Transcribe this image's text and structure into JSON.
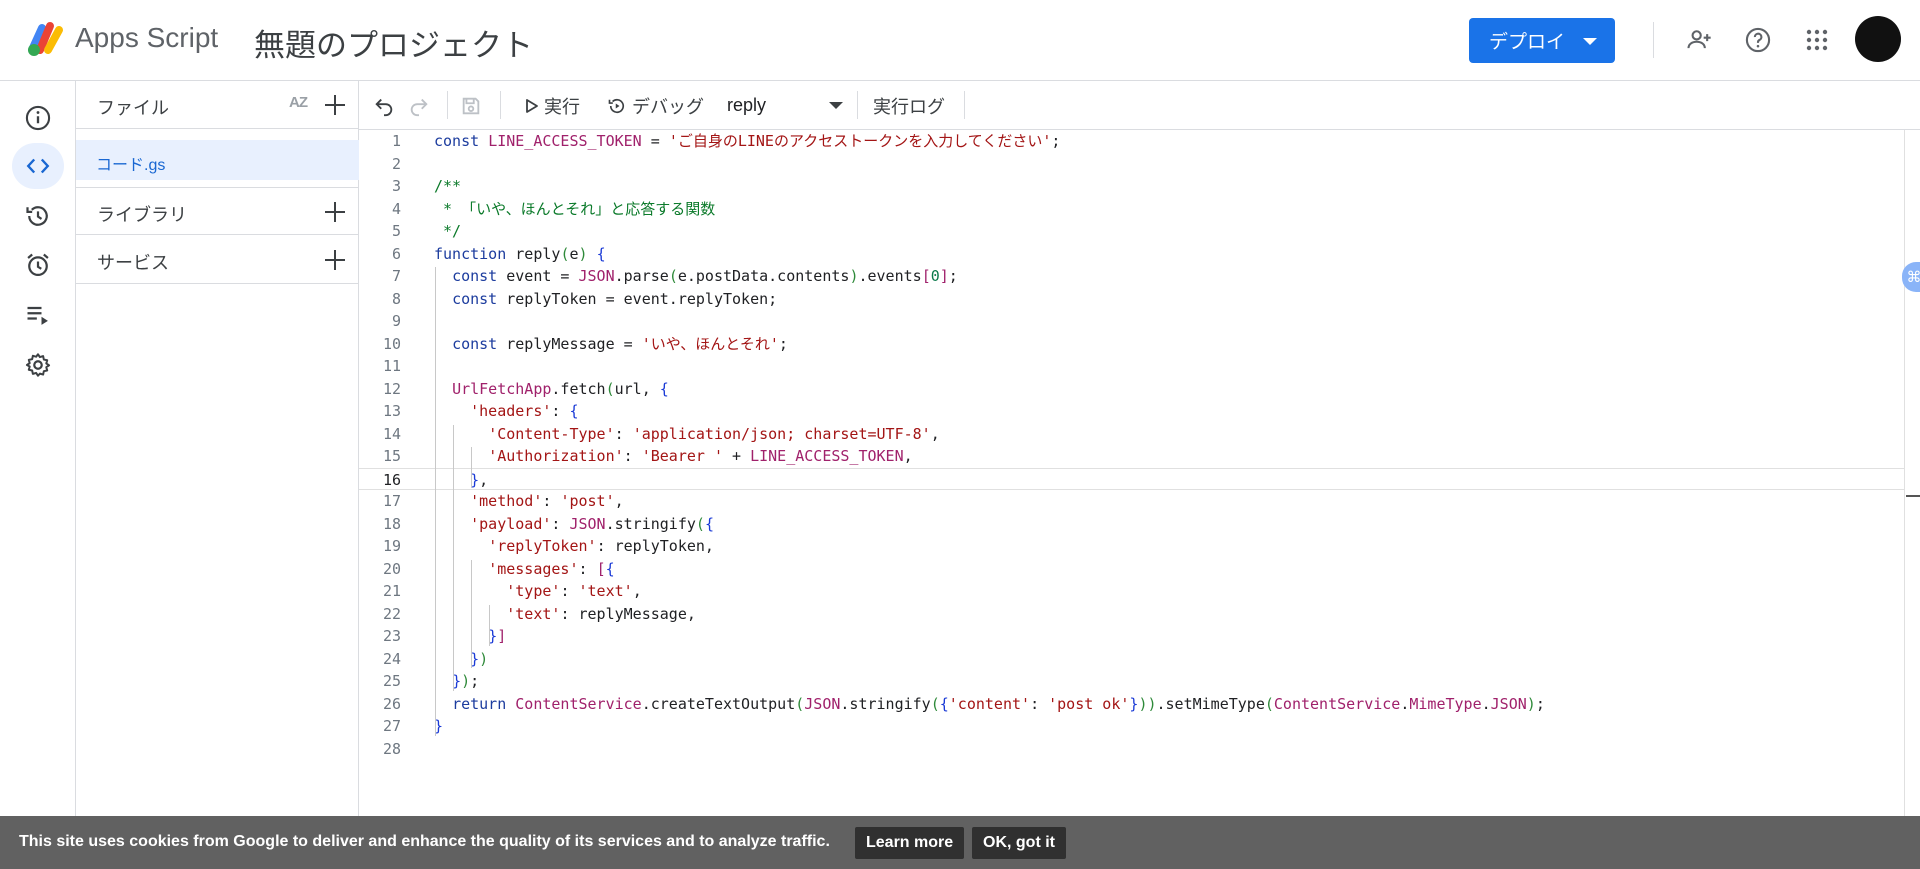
{
  "header": {
    "app_name": "Apps Script",
    "project_title": "無題のプロジェクト",
    "deploy_label": "デプロイ",
    "icons": [
      "add-person-icon",
      "help-icon",
      "apps-grid-icon"
    ]
  },
  "rail": {
    "items": [
      {
        "name": "overview",
        "icon": "info-icon",
        "active": false
      },
      {
        "name": "editor",
        "icon": "code-icon",
        "active": true
      },
      {
        "name": "history",
        "icon": "history-icon",
        "active": false
      },
      {
        "name": "triggers",
        "icon": "alarm-icon",
        "active": false
      },
      {
        "name": "executions",
        "icon": "list-play-icon",
        "active": false
      },
      {
        "name": "settings",
        "icon": "gear-icon",
        "active": false
      }
    ]
  },
  "files_panel": {
    "files_label": "ファイル",
    "sort_label": "AZ",
    "current_file": "コード.gs",
    "libraries_label": "ライブラリ",
    "services_label": "サービス"
  },
  "toolbar": {
    "run_label": "実行",
    "debug_label": "デバッグ",
    "function_selected": "reply",
    "log_label": "実行ログ"
  },
  "editor": {
    "current_line": 16,
    "lines": [
      "const LINE_ACCESS_TOKEN = 'ご自身のLINEのアクセストークンを入力してください';",
      "",
      "/**",
      " * 「いや、ほんとそれ」と応答する関数",
      " */",
      "function reply(e) {",
      "  const event = JSON.parse(e.postData.contents).events[0];",
      "  const replyToken = event.replyToken;",
      "",
      "  const replyMessage = 'いや、ほんとそれ';",
      "",
      "  UrlFetchApp.fetch(url, {",
      "    'headers': {",
      "      'Content-Type': 'application/json; charset=UTF-8',",
      "      'Authorization': 'Bearer ' + LINE_ACCESS_TOKEN,",
      "    },",
      "    'method': 'post',",
      "    'payload': JSON.stringify({",
      "      'replyToken': replyToken,",
      "      'messages': [{",
      "        'type': 'text',",
      "        'text': replyMessage,",
      "      }]",
      "    })",
      "  });",
      "  return ContentService.createTextOutput(JSON.stringify({'content': 'post ok'})).setMimeType(ContentService.MimeType.JSON);",
      "}",
      ""
    ]
  },
  "cookie_bar": {
    "text": "This site uses cookies from Google to deliver and enhance the quality of its services and to analyze traffic.",
    "learn_more": "Learn more",
    "ok": "OK, got it"
  },
  "colors": {
    "accent": "#1a73e8",
    "active_bg": "#e8f0fe",
    "cookie_bg": "#616161"
  }
}
